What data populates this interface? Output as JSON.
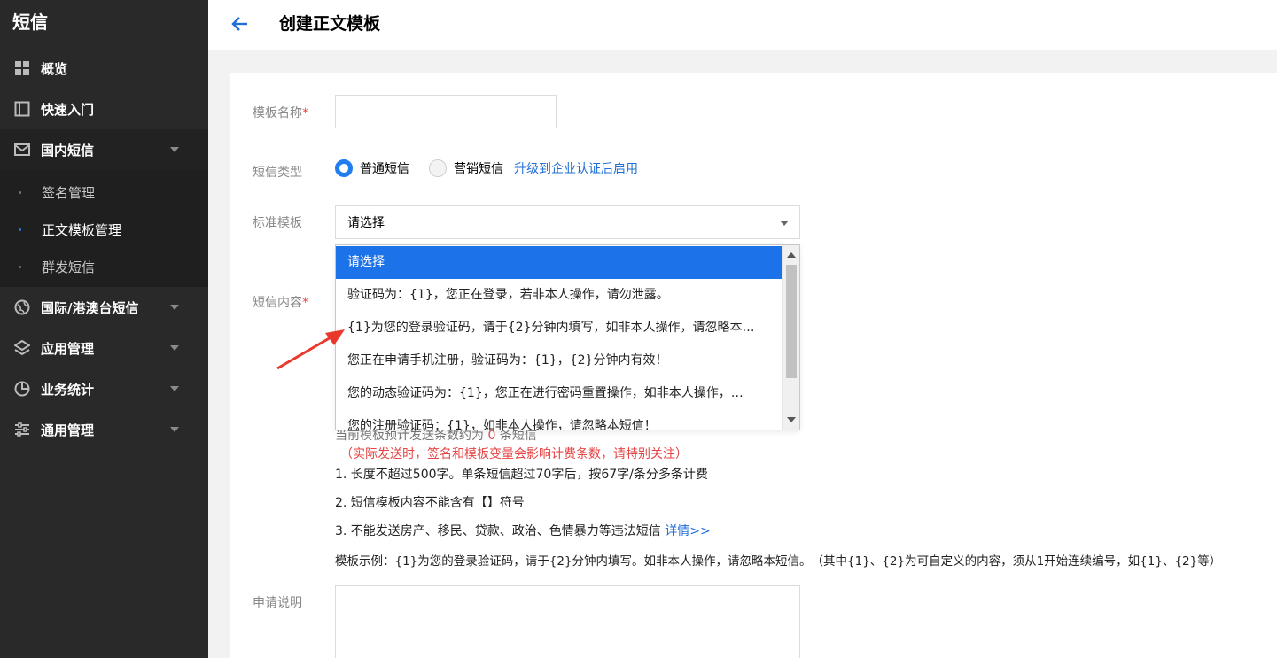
{
  "sidebar": {
    "brand": "短信",
    "items": [
      {
        "label": "概览",
        "icon": "grid-icon"
      },
      {
        "label": "快速入门",
        "icon": "book-icon"
      },
      {
        "label": "国内短信",
        "icon": "mail-icon",
        "expanded": true,
        "children": [
          {
            "label": "签名管理"
          },
          {
            "label": "正文模板管理",
            "active": true
          },
          {
            "label": "群发短信"
          }
        ]
      },
      {
        "label": "国际/港澳台短信",
        "icon": "globe-icon"
      },
      {
        "label": "应用管理",
        "icon": "layers-icon"
      },
      {
        "label": "业务统计",
        "icon": "pie-chart-icon"
      },
      {
        "label": "通用管理",
        "icon": "sliders-icon"
      }
    ]
  },
  "header": {
    "title": "创建正文模板"
  },
  "form": {
    "name_label": "模板名称",
    "type_label": "短信类型",
    "type_options": [
      "普通短信",
      "营销短信"
    ],
    "type_selected": "普通短信",
    "upgrade_link": "升级到企业认证后启用",
    "standard_label": "标准模板",
    "standard_selected": "请选择",
    "content_label": "短信内容",
    "apply_label": "申请说明",
    "required_mark": "*"
  },
  "dropdown": {
    "options": [
      "请选择",
      "验证码为：{1}，您正在登录，若非本人操作，请勿泄露。",
      "{1}为您的登录验证码，请于{2}分钟内填写，如非本人操作，请忽略本…",
      "您正在申请手机注册，验证码为：{1}，{2}分钟内有效！",
      "您的动态验证码为：{1}，您正在进行密码重置操作，如非本人操作，…",
      "您的注册验证码：{1}，如非本人操作，请忽略本短信！"
    ],
    "selected_index": 0
  },
  "hints": {
    "count_prefix": "当前模板预计发送条数约为",
    "count_value": "0",
    "count_suffix": "条短信",
    "warning": "（实际发送时，签名和模板变量会影响计费条数，请特别关注）",
    "rule1": "1. 长度不超过500字。单条短信超过70字后，按67字/条分多条计费",
    "rule2": "2. 短信模板内容不能含有【】符号",
    "rule3": "3. 不能发送房产、移民、贷款、政治、色情暴力等违法短信",
    "rule3_link": "详情>>",
    "example": "模板示例：{1}为您的登录验证码，请于{2}分钟内填写。如非本人操作，请忽略本短信。　（其中{1}、{2}为可自定义的内容，须从1开始连续编号，如{1}、{2}等）"
  },
  "colors": {
    "sidebar_bg": "#292929",
    "accent": "#1f7ded",
    "selected_option_bg": "#1c72e8",
    "required": "#e54545",
    "annotation_arrow": "#e8392c"
  }
}
